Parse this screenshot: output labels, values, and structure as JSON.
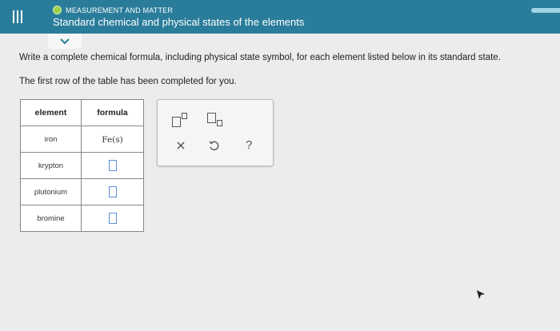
{
  "header": {
    "topic": "MEASUREMENT AND MATTER",
    "title": "Standard chemical and physical states of the elements",
    "topic_status_color": "#9bd14b",
    "bar_color": "#2a7d9a"
  },
  "question": {
    "instruction": "Write a complete chemical formula, including physical state symbol, for each element listed below in its standard state.",
    "note": "The first row of the table has been completed for you."
  },
  "table": {
    "headers": [
      "element",
      "formula"
    ],
    "rows": [
      {
        "element": "iron",
        "formula": "Fe(s)"
      },
      {
        "element": "krypton",
        "formula": ""
      },
      {
        "element": "plutonium",
        "formula": ""
      },
      {
        "element": "bromine",
        "formula": ""
      }
    ]
  },
  "toolbar": {
    "buttons": [
      "superscript-icon",
      "subscript-icon",
      "clear-icon",
      "undo-icon",
      "help-icon"
    ],
    "help_label": "?"
  },
  "icons": {
    "menu": "menu-icon",
    "expand": "chevron-down-icon"
  }
}
